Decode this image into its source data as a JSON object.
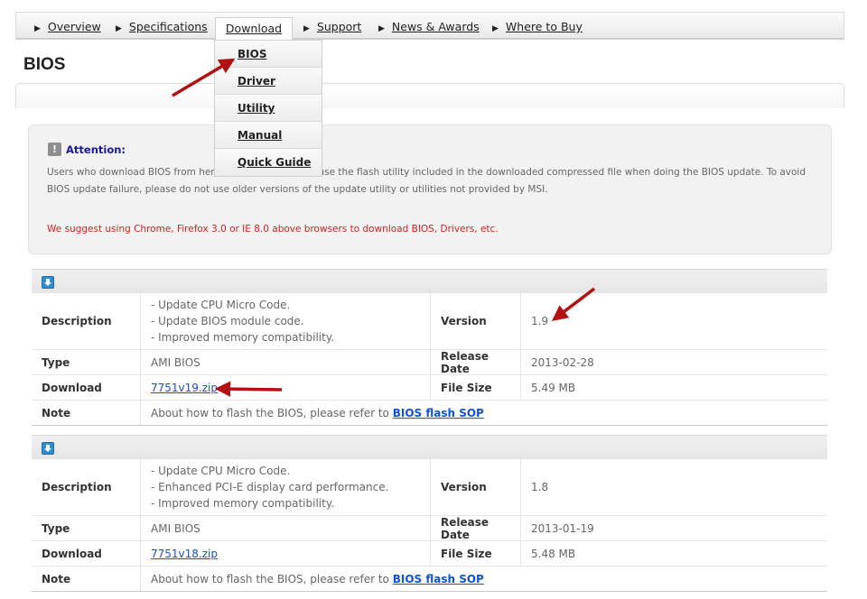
{
  "nav": {
    "items": [
      "Overview",
      "Specifications",
      "Download",
      "Support",
      "News & Awards",
      "Where to Buy"
    ],
    "active": "Download"
  },
  "page_title": "BIOS",
  "dropdown": {
    "items": [
      "BIOS",
      "Driver",
      "Utility",
      "Manual",
      "Quick Guide"
    ]
  },
  "attention": {
    "title": "Attention:",
    "body_line1_left": "Users who download BIOS from here",
    "body_line1_right": "hould use the flash utility included in the downloaded compressed file when doing the BIOS update. To avoid",
    "body_line2": "BIOS update failure, please do not use older versions of the update utility or utilities not provided by MSI.",
    "warning": "We suggest using Chrome, Firefox 3.0 or IE 8.0 above browsers to download BIOS, Drivers, etc.",
    "icon": "exclamation-icon"
  },
  "labels": {
    "description": "Description",
    "version": "Version",
    "type": "Type",
    "release_date": "Release Date",
    "download": "Download",
    "file_size": "File Size",
    "note": "Note",
    "note_text": "About how to flash the BIOS, please refer to",
    "note_link": "BIOS flash SOP"
  },
  "entries": [
    {
      "desc": [
        "- Update CPU Micro Code.",
        "- Update BIOS module code.",
        "- Improved memory compatibility."
      ],
      "version": "1.9",
      "type": "AMI BIOS",
      "release_date": "2013-02-28",
      "file": "7751v19.zip",
      "size": "5.49 MB"
    },
    {
      "desc": [
        "- Update CPU Micro Code.",
        "- Enhanced PCI-E display card performance.",
        "- Improved memory compatibility."
      ],
      "version": "1.8",
      "type": "AMI BIOS",
      "release_date": "2013-01-19",
      "file": "7751v18.zip",
      "size": "5.48 MB"
    }
  ],
  "colors": {
    "annotation_arrow": "#b31212",
    "warning_text": "#d42020",
    "attention_title": "#1a1a99",
    "link": "#1155cc"
  }
}
